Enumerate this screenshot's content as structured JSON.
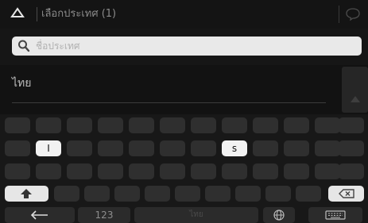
{
  "header": {
    "title": "เลือกประเทศ (1)",
    "back_icon": "triangle-up-icon",
    "voice_icon": "speech-bubble-icon"
  },
  "search": {
    "placeholder": "ชื่อประเทศ",
    "value": ""
  },
  "list": {
    "items": [
      {
        "label": "ไทย"
      }
    ]
  },
  "keyboard": {
    "highlighted_keys": [
      "I",
      "s"
    ],
    "num_label": "123",
    "space_label": "ไทย"
  },
  "colors": {
    "header_bg": "#141414",
    "search_bg": "#e9e9e9",
    "key_bg": "#2f2f2f",
    "key_highlight": "#f2f2f2"
  }
}
